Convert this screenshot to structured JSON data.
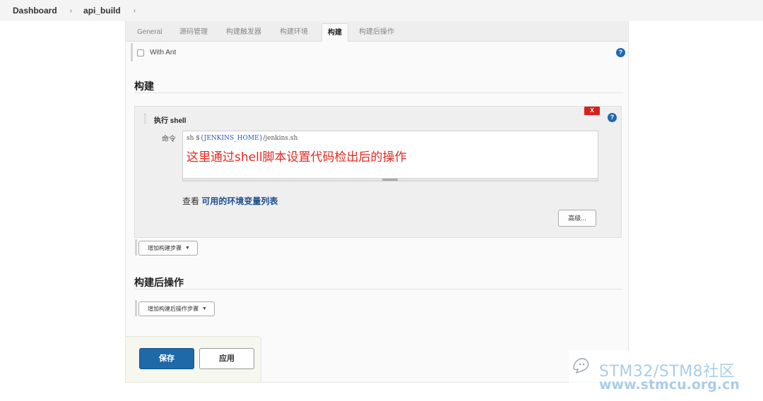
{
  "breadcrumb": {
    "items": [
      "Dashboard",
      "api_build"
    ],
    "separator": "›"
  },
  "tabs": [
    {
      "label": "General",
      "active": false
    },
    {
      "label": "源码管理",
      "active": false
    },
    {
      "label": "构建触发器",
      "active": false
    },
    {
      "label": "构建环境",
      "active": false
    },
    {
      "label": "构建",
      "active": true
    },
    {
      "label": "构建后操作",
      "active": false
    }
  ],
  "build_env": {
    "with_ant_label": "With Ant",
    "with_ant_checked": false
  },
  "build_section": {
    "title": "构建",
    "step": {
      "title": "执行 shell",
      "delete_label": "X",
      "command_label": "命令",
      "command_prefix": "sh $",
      "command_var": "{JENKINS_HOME}",
      "command_suffix": "/jenkins.sh",
      "annotation": "这里通过shell脚本设置代码检出后的操作",
      "env_prefix": "查看 ",
      "env_link": "可用的环境变量列表",
      "advanced_label": "高级..."
    },
    "add_step_label": "增加构建步骤"
  },
  "post_build_section": {
    "title": "构建后操作",
    "add_post_step_label": "增加构建后操作步骤"
  },
  "footer": {
    "save_label": "保存",
    "apply_label": "应用"
  },
  "help_icon_text": "?",
  "watermark": {
    "line1": "STM32/STM8社区",
    "line2": "www.stmcu.org.cn"
  },
  "colors": {
    "primary_button": "#1f69a8",
    "delete_button": "#d8201c",
    "annotation": "#e8271f",
    "link": "#1d4f8e",
    "help_icon": "#1d68b4",
    "watermark": "#a9cde9"
  }
}
